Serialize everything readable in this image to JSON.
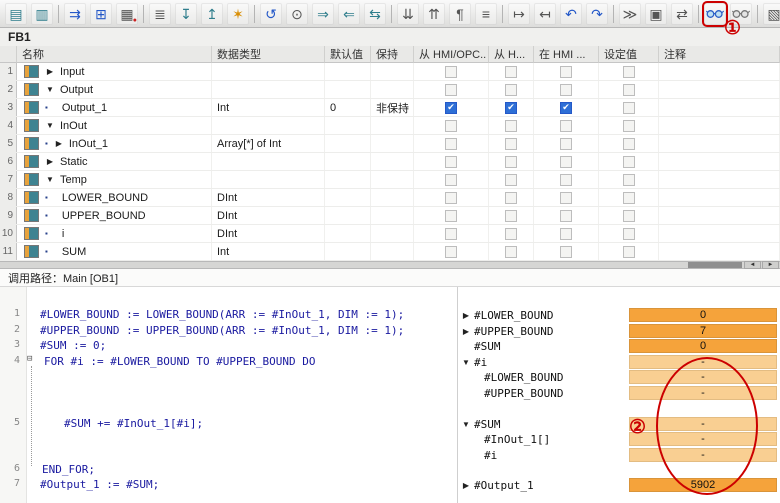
{
  "window": {
    "title": "FB1"
  },
  "annotations": {
    "marker_one": "①",
    "marker_two": "②"
  },
  "toolbar": {
    "icons": [
      {
        "name": "insert-title-icon",
        "glyph": "▤"
      },
      {
        "name": "insert-comment-icon",
        "glyph": "▥"
      },
      {
        "name": "insert-row-icon",
        "glyph": "⇉"
      },
      {
        "name": "add-row-icon",
        "glyph": "⊞"
      },
      {
        "name": "delete-row-icon",
        "glyph": "▦",
        "badge": "●"
      },
      {
        "name": "keep-actual-values-icon",
        "glyph": "≣"
      },
      {
        "name": "insert-row-below-icon",
        "glyph": "↧"
      },
      {
        "name": "add-row-above-icon",
        "glyph": "↥"
      },
      {
        "name": "update-interface-icon",
        "glyph": "✶"
      },
      {
        "name": "reset-start-values-icon",
        "glyph": "↺"
      },
      {
        "name": "snapshot-values-icon",
        "glyph": "⊙"
      },
      {
        "name": "copy-snapshot-icon",
        "glyph": "⇒"
      },
      {
        "name": "load-snapshot-icon",
        "glyph": "⇐"
      },
      {
        "name": "copy-start-values-icon",
        "glyph": "⇆"
      },
      {
        "name": "expand-all-icon",
        "glyph": "⇊"
      },
      {
        "name": "collapse-all-icon",
        "glyph": "⇈"
      },
      {
        "name": "absolute-operands-icon",
        "glyph": "¶"
      },
      {
        "name": "format-code-icon",
        "glyph": "≡"
      },
      {
        "name": "indent-icon",
        "glyph": "↦"
      },
      {
        "name": "outdent-icon",
        "glyph": "↤"
      },
      {
        "name": "undo-icon",
        "glyph": "↶"
      },
      {
        "name": "redo-icon",
        "glyph": "↷"
      },
      {
        "name": "next-error-icon",
        "glyph": "≫"
      },
      {
        "name": "call-environment-icon",
        "glyph": "▣"
      },
      {
        "name": "cross-reference-icon",
        "glyph": "⇄"
      },
      {
        "name": "monitoring-on-off-icon",
        "glyph": ""
      },
      {
        "name": "monitor-selection-icon",
        "glyph": ""
      },
      {
        "name": "block-properties-icon",
        "glyph": "▧"
      }
    ]
  },
  "interface_table": {
    "headers": {
      "name": "名称",
      "data_type": "数据类型",
      "default_value": "默认值",
      "retain": "保持",
      "from_hmi_opc": "从 HMI/OPC..",
      "from_h": "从 H...",
      "in_hmi": "在 HMI ...",
      "setpoint": "设定值",
      "comment": "注释"
    },
    "check_glyph": "✔",
    "bullet": "▪",
    "rows": [
      {
        "num": "1",
        "expander": "▶",
        "name": "Input"
      },
      {
        "num": "2",
        "expander": "▼",
        "name": "Output"
      },
      {
        "num": "3",
        "name": "Output_1",
        "data_type": "Int",
        "default_value": "0",
        "retain": "非保持"
      },
      {
        "num": "4",
        "expander": "▼",
        "name": "InOut"
      },
      {
        "num": "5",
        "expander": "▶",
        "name": "InOut_1",
        "data_type": "Array[*] of Int"
      },
      {
        "num": "6",
        "expander": "▶",
        "name": "Static"
      },
      {
        "num": "7",
        "expander": "▼",
        "name": "Temp"
      },
      {
        "num": "8",
        "name": "LOWER_BOUND",
        "data_type": "DInt"
      },
      {
        "num": "9",
        "name": "UPPER_BOUND",
        "data_type": "DInt"
      },
      {
        "num": "10",
        "name": "i",
        "data_type": "DInt"
      },
      {
        "num": "11",
        "name": "SUM",
        "data_type": "Int"
      }
    ]
  },
  "scrollbar": {
    "left_arrow": "◄",
    "right_arrow": "►"
  },
  "call_path": {
    "text": "调用路径：Main [OB1]"
  },
  "code": {
    "fold_marker": "⊟",
    "lines": [
      {
        "num": "1",
        "text": "#LOWER_BOUND := LOWER_BOUND(ARR := #InOut_1, DIM := 1);"
      },
      {
        "num": "2",
        "text": "#UPPER_BOUND := UPPER_BOUND(ARR := #InOut_1, DIM := 1);"
      },
      {
        "num": "3",
        "text": "#SUM := 0;"
      },
      {
        "num": "4",
        "text": "FOR #i := #LOWER_BOUND TO #UPPER_BOUND DO"
      },
      {
        "num": "5",
        "text": "#SUM += #InOut_1[#i];"
      },
      {
        "num": "6",
        "text": "END_FOR;"
      },
      {
        "num": "7",
        "text": "#Output_1 := #SUM;"
      }
    ]
  },
  "monitor": {
    "rows": [
      {
        "tri": "▶",
        "name": "#LOWER_BOUND",
        "value": "0"
      },
      {
        "tri": "▶",
        "name": "#UPPER_BOUND",
        "value": "7"
      },
      {
        "tri": "",
        "name": "#SUM",
        "value": "0"
      },
      {
        "tri": "▼",
        "name": "#i",
        "value": "-"
      },
      {
        "tri": "",
        "name": "#LOWER_BOUND",
        "value": "-"
      },
      {
        "tri": "",
        "name": "#UPPER_BOUND",
        "value": "-"
      },
      {
        "tri": "▼",
        "name": "#SUM",
        "value": "-"
      },
      {
        "tri": "",
        "name": "#InOut_1[]",
        "value": "-"
      },
      {
        "tri": "",
        "name": "#i",
        "value": "-"
      },
      {
        "tri": "▶",
        "name": "#Output_1",
        "value": "5902"
      }
    ]
  },
  "colors": {
    "monitor_value_bg": "#F5A33B",
    "monitor_dash_bg": "#F9CF92",
    "checkbox_checked": "#2E6FD6",
    "annotation_red": "#CC0000"
  }
}
